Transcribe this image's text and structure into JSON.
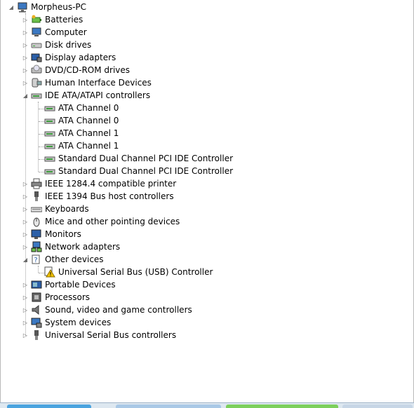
{
  "tree": {
    "root": {
      "label": "Morpheus-PC",
      "icon": "computer-icon"
    },
    "categories": [
      {
        "label": "Batteries",
        "icon": "battery-icon",
        "expanded": false
      },
      {
        "label": "Computer",
        "icon": "computer-icon",
        "expanded": false
      },
      {
        "label": "Disk drives",
        "icon": "disk-drive-icon",
        "expanded": false
      },
      {
        "label": "Display adapters",
        "icon": "display-adapter-icon",
        "expanded": false
      },
      {
        "label": "DVD/CD-ROM drives",
        "icon": "dvd-drive-icon",
        "expanded": false
      },
      {
        "label": "Human Interface Devices",
        "icon": "hid-icon",
        "expanded": false
      },
      {
        "label": "IDE ATA/ATAPI controllers",
        "icon": "ide-controller-icon",
        "expanded": true
      },
      {
        "label": "IEEE 1284.4 compatible printer",
        "icon": "printer-icon",
        "expanded": false
      },
      {
        "label": "IEEE 1394 Bus host controllers",
        "icon": "ieee1394-icon",
        "expanded": false
      },
      {
        "label": "Keyboards",
        "icon": "keyboard-icon",
        "expanded": false
      },
      {
        "label": "Mice and other pointing devices",
        "icon": "mouse-icon",
        "expanded": false
      },
      {
        "label": "Monitors",
        "icon": "monitor-icon",
        "expanded": false
      },
      {
        "label": "Network adapters",
        "icon": "network-adapter-icon",
        "expanded": false
      },
      {
        "label": "Other devices",
        "icon": "other-devices-icon",
        "expanded": true
      },
      {
        "label": "Portable Devices",
        "icon": "portable-device-icon",
        "expanded": false
      },
      {
        "label": "Processors",
        "icon": "processor-icon",
        "expanded": false
      },
      {
        "label": "Sound, video and game controllers",
        "icon": "speaker-icon",
        "expanded": false
      },
      {
        "label": "System devices",
        "icon": "system-device-icon",
        "expanded": false
      },
      {
        "label": "Universal Serial Bus controllers",
        "icon": "usb-icon",
        "expanded": false
      }
    ],
    "ide_children": [
      {
        "label": "ATA Channel 0",
        "icon": "ide-channel-icon"
      },
      {
        "label": "ATA Channel 0",
        "icon": "ide-channel-icon"
      },
      {
        "label": "ATA Channel 1",
        "icon": "ide-channel-icon"
      },
      {
        "label": "ATA Channel 1",
        "icon": "ide-channel-icon"
      },
      {
        "label": "Standard Dual Channel PCI IDE Controller",
        "icon": "ide-channel-icon"
      },
      {
        "label": "Standard Dual Channel PCI IDE Controller",
        "icon": "ide-channel-icon"
      }
    ],
    "other_children": [
      {
        "label": "Universal Serial Bus (USB) Controller",
        "icon": "warning-device-icon"
      }
    ]
  },
  "colors": {
    "warning": "#f2c200",
    "accent": "#3a6ea5"
  }
}
